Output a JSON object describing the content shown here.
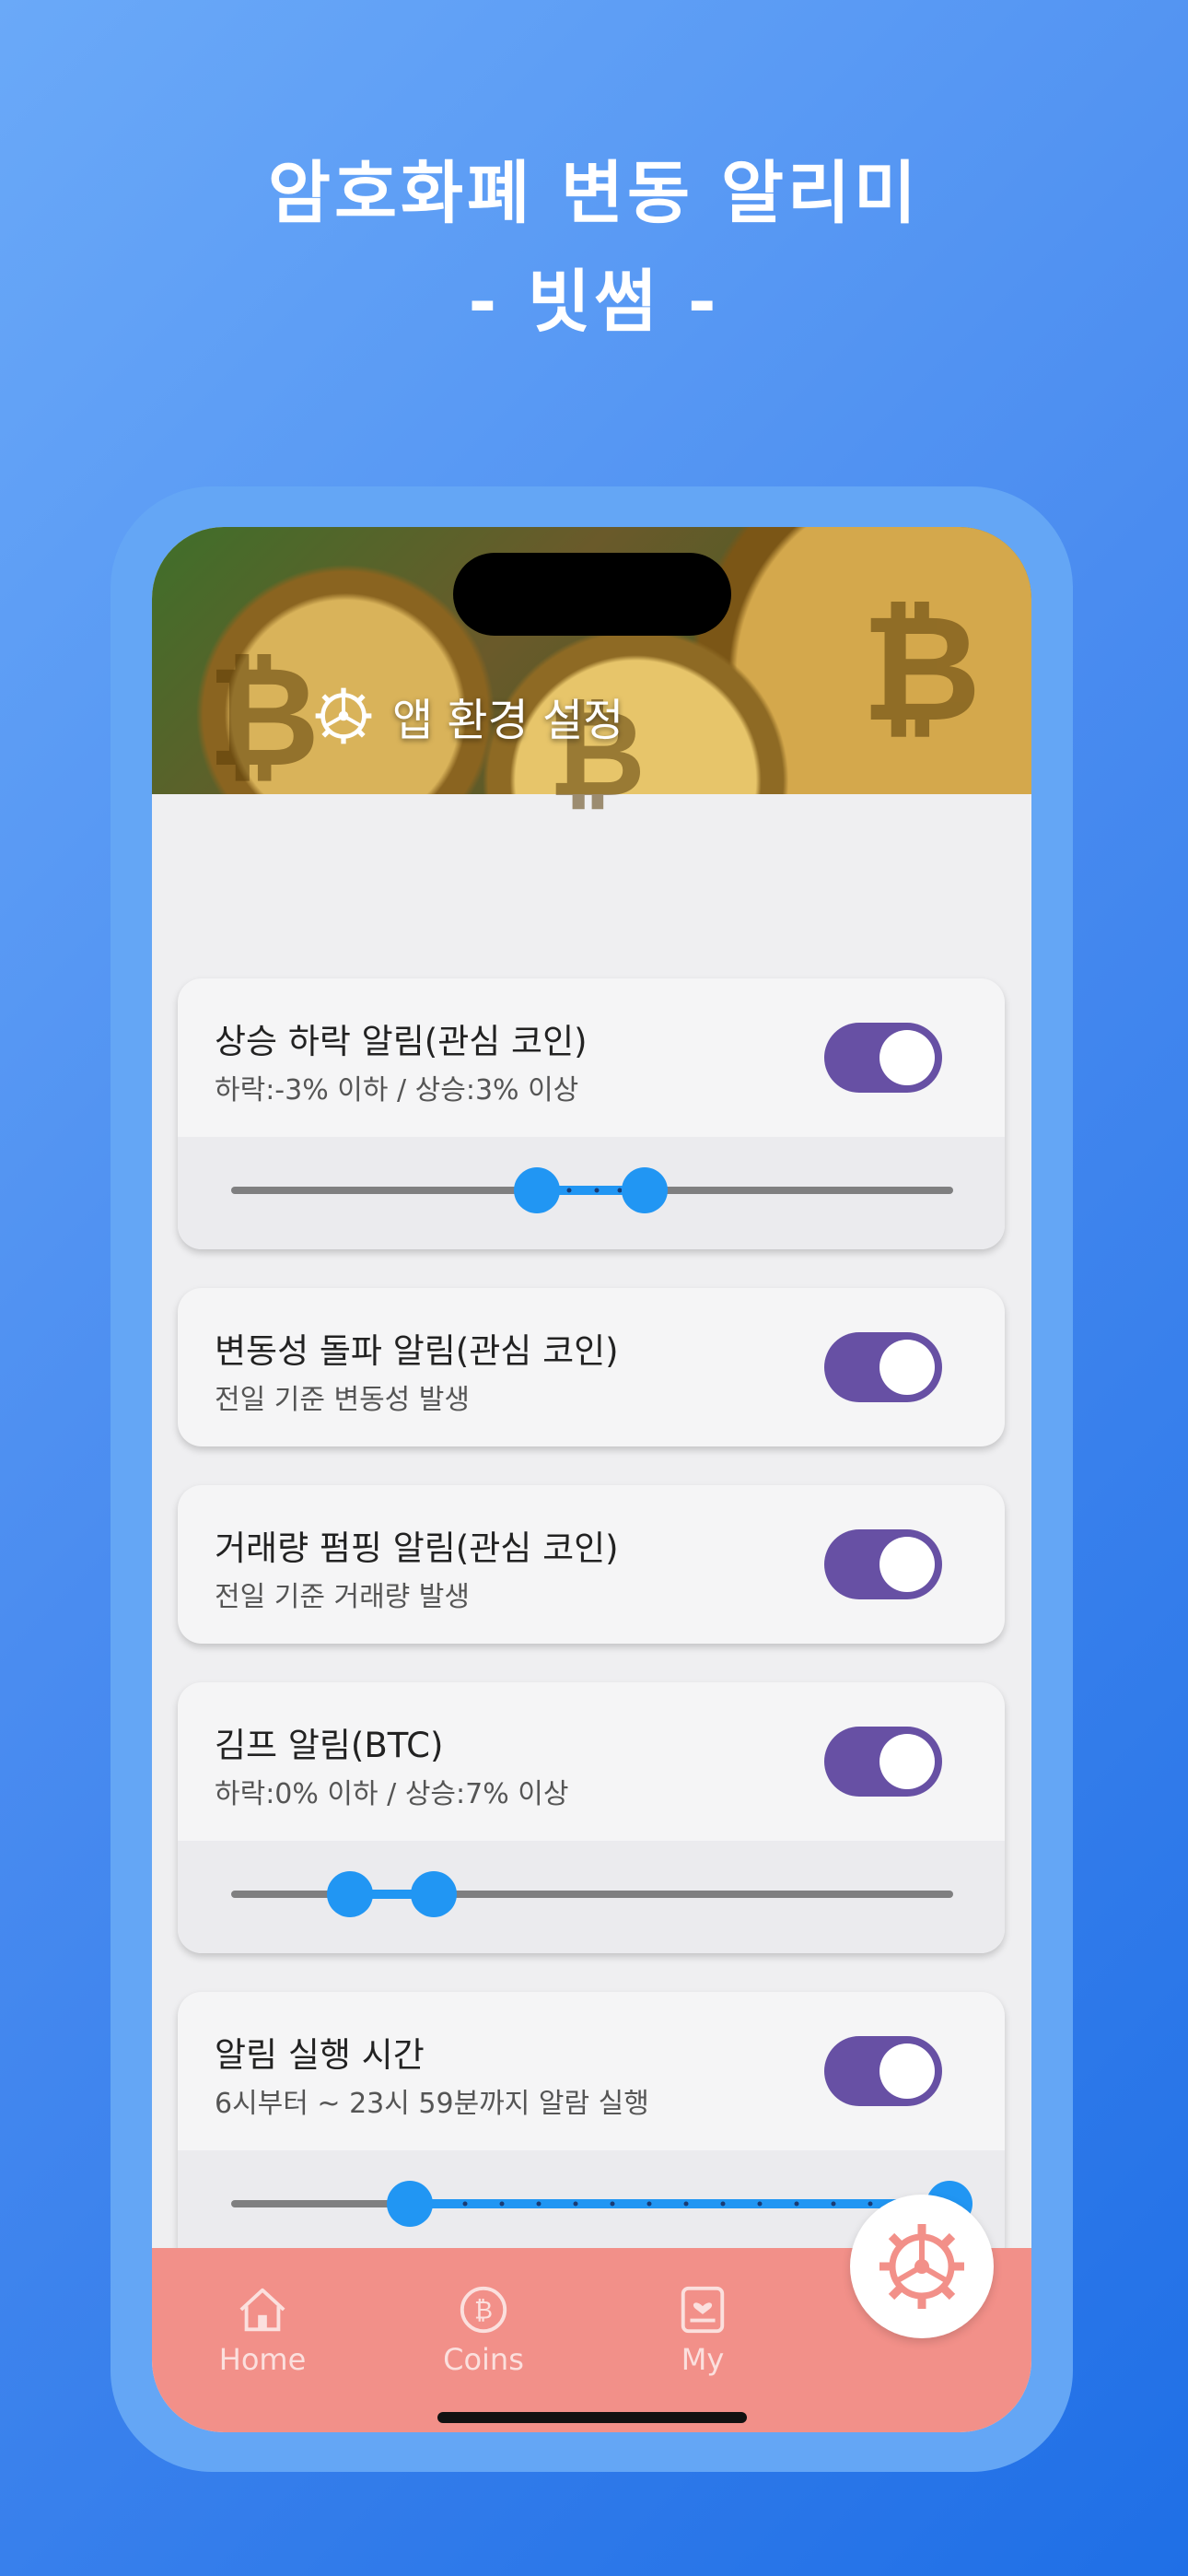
{
  "promo": {
    "title_line1": "암호화폐 변동 알리미",
    "title_line2": "- 빗썸 -"
  },
  "header": {
    "title": "앱 환경 설정",
    "icon": "settings-wheel-icon"
  },
  "cards": [
    {
      "title": "상승 하락 알림(관심 코인)",
      "subtitle": "하락:-3% 이하 / 상승:3% 이상",
      "enabled": true,
      "range": {
        "low": -3,
        "high": 3,
        "min_fraction": 0.0,
        "low_fraction": 0.42,
        "high_fraction": 0.57
      }
    },
    {
      "title": "변동성 돌파 알림(관심 코인)",
      "subtitle": "전일 기준 변동성 발생",
      "enabled": true
    },
    {
      "title": "거래량 펌핑 알림(관심 코인)",
      "subtitle": "전일 기준 거래량 발생",
      "enabled": true
    },
    {
      "title": "김프 알림(BTC)",
      "subtitle": "하락:0% 이하 / 상승:7% 이상",
      "enabled": true,
      "range": {
        "low": 0,
        "high": 7,
        "low_fraction": 0.17,
        "high_fraction": 0.28
      }
    },
    {
      "title": "알림 실행 시간",
      "subtitle": "6시부터 ~ 23시 59분까지 알람 실행",
      "enabled": true,
      "range": {
        "low": 6,
        "high": 23.98,
        "low_fraction": 0.25,
        "high_fraction": 1.0
      }
    }
  ],
  "nav": {
    "items": [
      {
        "label": "Home",
        "icon": "home-icon"
      },
      {
        "label": "Coins",
        "icon": "bitcoin-coin-icon"
      },
      {
        "label": "My",
        "icon": "my-heart-card-icon"
      }
    ],
    "active_icon": "settings-wheel-icon"
  },
  "colors": {
    "accent_toggle": "#6750a4",
    "slider_active": "#2196f3",
    "nav_background": "#f29089",
    "background_gradient": [
      "#6aa9f8",
      "#1f6fe6"
    ]
  }
}
